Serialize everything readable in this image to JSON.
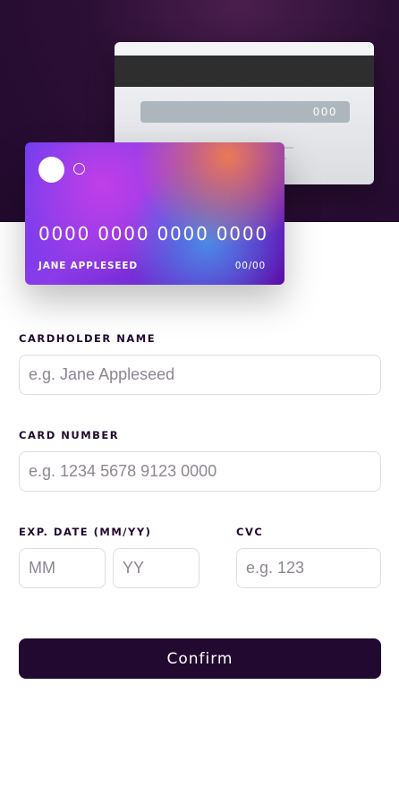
{
  "card_back": {
    "cvc": "000"
  },
  "card_front": {
    "number": "0000 0000 0000 0000",
    "holder": "JANE APPLESEED",
    "expiry": "00/00"
  },
  "form": {
    "name_label": "CARDHOLDER NAME",
    "name_placeholder": "e.g. Jane Appleseed",
    "number_label": "CARD NUMBER",
    "number_placeholder": "e.g. 1234 5678 9123 0000",
    "exp_label": "EXP. DATE (MM/YY)",
    "month_placeholder": "MM",
    "year_placeholder": "YY",
    "cvc_label": "CVC",
    "cvc_placeholder": "e.g. 123",
    "confirm_label": "Confirm"
  },
  "colors": {
    "dark_violet": "#21092f",
    "input_border": "#dedddf",
    "placeholder": "#8e8593"
  }
}
